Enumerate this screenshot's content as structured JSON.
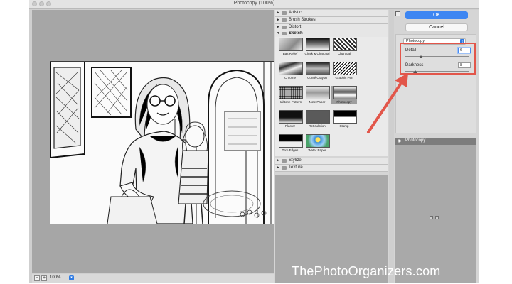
{
  "window": {
    "title": "Photocopy (100%)"
  },
  "preview": {
    "zoom": "100%",
    "zoom_out": "-",
    "zoom_in": "+"
  },
  "filter_gallery": {
    "categories": [
      {
        "label": "Artistic",
        "expanded": false
      },
      {
        "label": "Brush Strokes",
        "expanded": false
      },
      {
        "label": "Distort",
        "expanded": false
      },
      {
        "label": "Sketch",
        "expanded": true
      },
      {
        "label": "Stylize",
        "expanded": false
      },
      {
        "label": "Texture",
        "expanded": false
      }
    ],
    "sketch_filters": [
      {
        "label": "Bas Relief"
      },
      {
        "label": "Chalk & Charcoal"
      },
      {
        "label": "Charcoal"
      },
      {
        "label": "Chrome"
      },
      {
        "label": "Conté Crayon"
      },
      {
        "label": "Graphic Pen"
      },
      {
        "label": "Halftone Pattern"
      },
      {
        "label": "Note Paper"
      },
      {
        "label": "Photocopy"
      },
      {
        "label": "Plaster"
      },
      {
        "label": "Reticulation"
      },
      {
        "label": "Stamp"
      },
      {
        "label": "Torn Edges"
      },
      {
        "label": "Water Paper"
      }
    ],
    "selected": "Photocopy"
  },
  "dialog": {
    "ok_label": "OK",
    "cancel_label": "Cancel",
    "filter_select": "Photocopy",
    "params": {
      "detail_label": "Detail",
      "detail_value": "6",
      "detail_fraction": 0.24,
      "darkness_label": "Darkness",
      "darkness_value": "8",
      "darkness_fraction": 0.16
    }
  },
  "layers": {
    "items": [
      {
        "name": "Photocopy"
      }
    ]
  },
  "watermark": "ThePhotoOrganizers.com",
  "colors": {
    "accent": "#3d86f2",
    "highlight": "#e2564a",
    "canvas": "#a6a6a6"
  }
}
